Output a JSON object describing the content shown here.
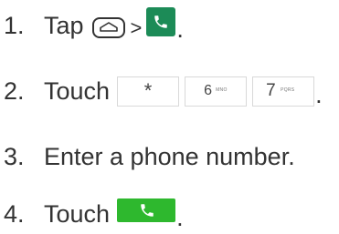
{
  "steps": [
    {
      "number": "1.",
      "text": "Tap",
      "separator": ">",
      "end": "."
    },
    {
      "number": "2.",
      "text": "Touch",
      "end": "."
    },
    {
      "number": "3.",
      "text": "Enter a phone number."
    },
    {
      "number": "4.",
      "text": "Touch",
      "end": "."
    }
  ],
  "keys": {
    "star": "*",
    "six": {
      "digit": "6",
      "letters": "MNO"
    },
    "seven": {
      "digit": "7",
      "letters": "PQRS"
    }
  },
  "icons": {
    "home": "home-key-icon",
    "phone_tile": "phone-app-icon",
    "call_button": "call-button-icon"
  },
  "colors": {
    "text": "#333333",
    "phone_tile": "#1c8b57",
    "call_button": "#2eb82e",
    "key_border": "#d9d9d9"
  }
}
